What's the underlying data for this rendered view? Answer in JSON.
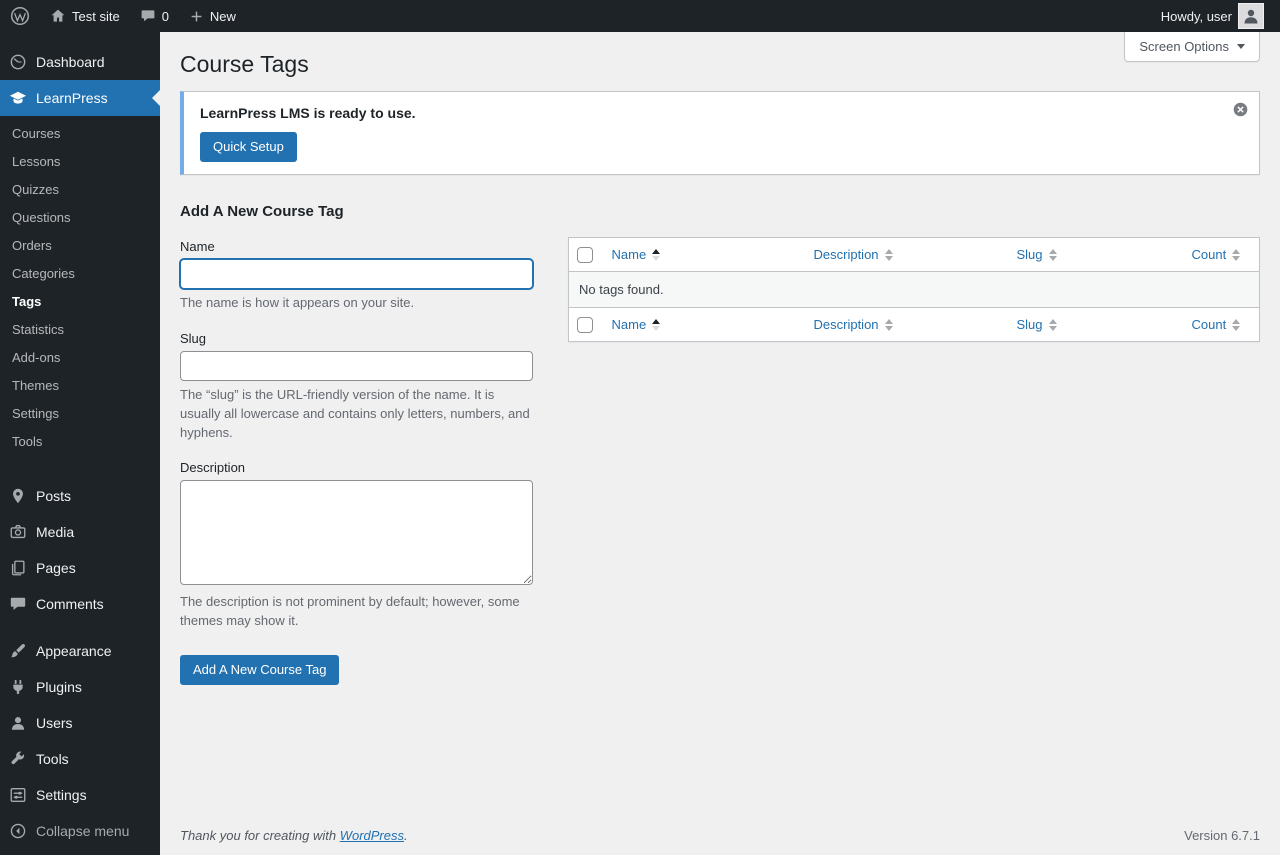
{
  "colors": {
    "accent": "#2271b1",
    "admin_bar_bg": "#1d2327",
    "notice_accent": "#72aee6",
    "content_bg": "#f0f0f1"
  },
  "icons": {
    "screen_options_arrow": "▼",
    "sort_asc": "▲",
    "sort_desc": "▼"
  },
  "admin_bar": {
    "site_name": "Test site",
    "comments_count": "0",
    "new_label": "New",
    "howdy": "Howdy, user"
  },
  "sidebar": {
    "items": [
      {
        "label": "Dashboard"
      },
      {
        "label": "LearnPress"
      },
      {
        "label": "Posts"
      },
      {
        "label": "Media"
      },
      {
        "label": "Pages"
      },
      {
        "label": "Comments"
      },
      {
        "label": "Appearance"
      },
      {
        "label": "Plugins"
      },
      {
        "label": "Users"
      },
      {
        "label": "Tools"
      },
      {
        "label": "Settings"
      }
    ],
    "learnpress_submenu": [
      {
        "label": "Courses"
      },
      {
        "label": "Lessons"
      },
      {
        "label": "Quizzes"
      },
      {
        "label": "Questions"
      },
      {
        "label": "Orders"
      },
      {
        "label": "Categories"
      },
      {
        "label": "Tags",
        "current": true
      },
      {
        "label": "Statistics"
      },
      {
        "label": "Add-ons"
      },
      {
        "label": "Themes"
      },
      {
        "label": "Settings"
      },
      {
        "label": "Tools"
      }
    ],
    "collapse_label": "Collapse menu"
  },
  "page": {
    "title": "Course Tags",
    "screen_options_label": "Screen Options",
    "notice": {
      "message": "LearnPress LMS is ready to use.",
      "button_label": "Quick Setup"
    },
    "form": {
      "heading": "Add A New Course Tag",
      "name_label": "Name",
      "name_value": "",
      "name_help": "The name is how it appears on your site.",
      "slug_label": "Slug",
      "slug_value": "",
      "slug_help": "The “slug” is the URL-friendly version of the name. It is usually all lowercase and contains only letters, numbers, and hyphens.",
      "description_label": "Description",
      "description_value": "",
      "description_help": "The description is not prominent by default; however, some themes may show it.",
      "submit_label": "Add A New Course Tag"
    },
    "table": {
      "columns": [
        {
          "label": "Name",
          "sorted": "asc"
        },
        {
          "label": "Description"
        },
        {
          "label": "Slug"
        },
        {
          "label": "Count"
        }
      ],
      "empty_message": "No tags found."
    },
    "footer": {
      "thanks_prefix": "Thank you for creating with",
      "wordpress_link": "WordPress",
      "thanks_suffix": ".",
      "version": "Version 6.7.1"
    }
  }
}
